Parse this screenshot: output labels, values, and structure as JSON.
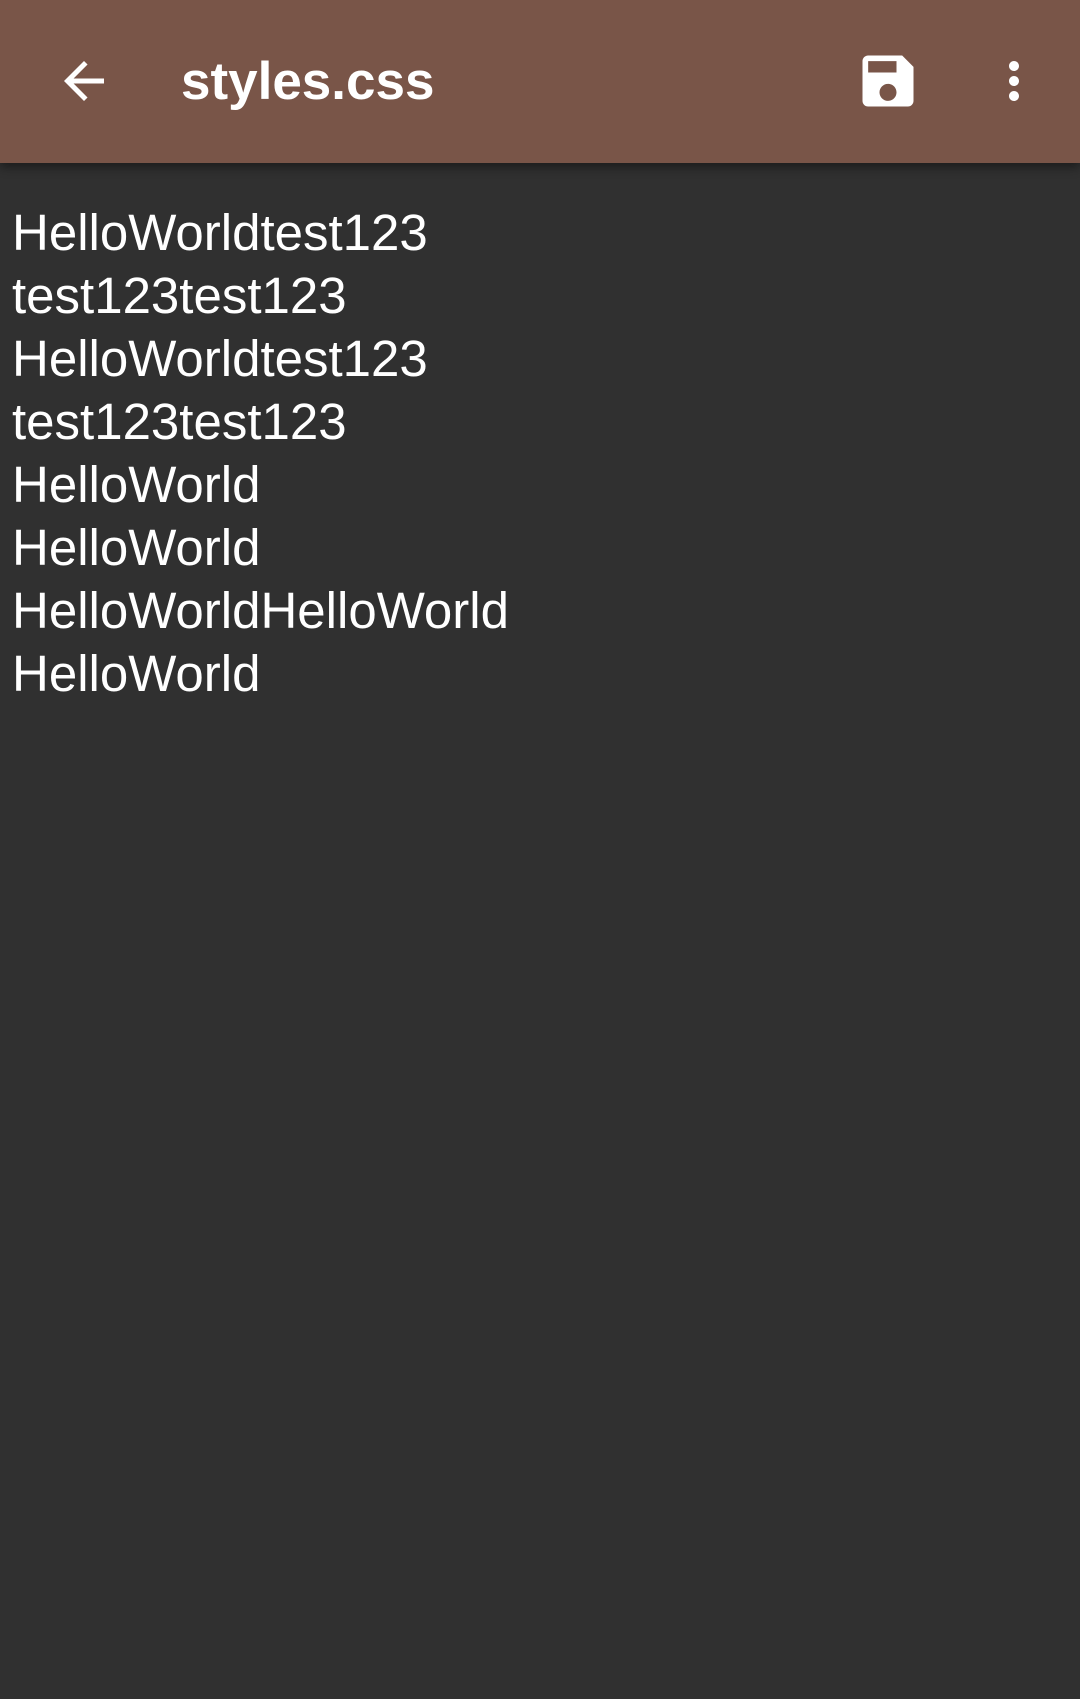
{
  "toolbar": {
    "title": "styles.css",
    "back_icon": "arrow-back-icon",
    "save_icon": "save-icon",
    "more_icon": "more-vert-icon",
    "background_color": "#795548"
  },
  "editor": {
    "background_color": "#303030",
    "lines": [
      "HelloWorldtest123",
      "test123test123",
      "HelloWorldtest123",
      "test123test123",
      "HelloWorld",
      "HelloWorld",
      "HelloWorldHelloWorld",
      "HelloWorld"
    ]
  }
}
